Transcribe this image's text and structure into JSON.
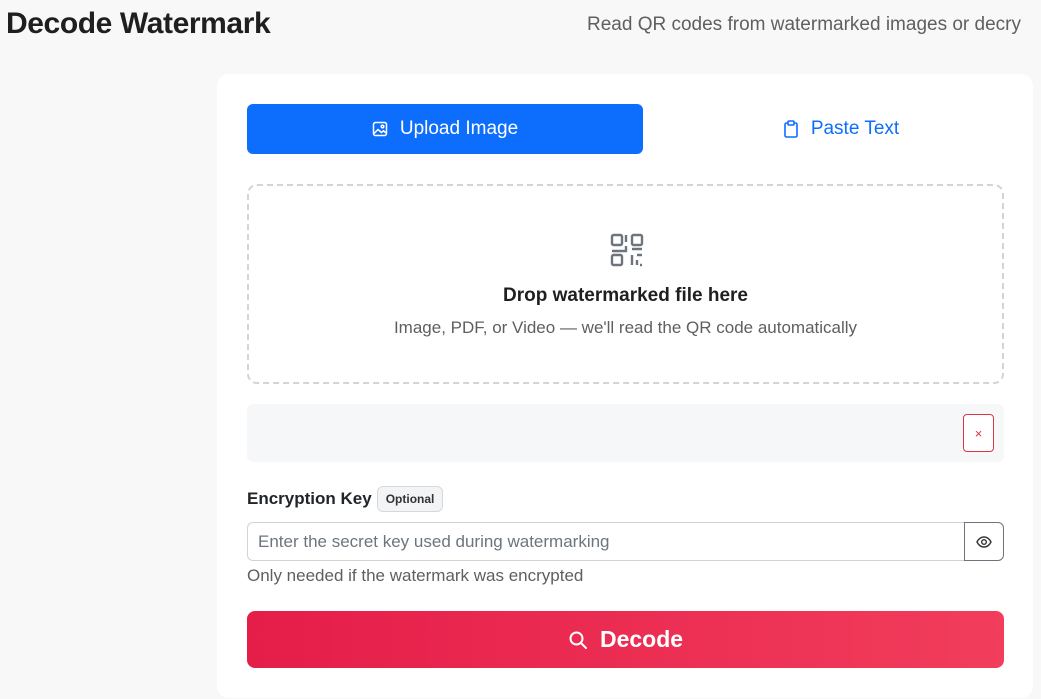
{
  "header": {
    "title": "Decode Watermark",
    "subtitle": "Read QR codes from watermarked images or decry"
  },
  "tabs": {
    "upload_label": "Upload Image",
    "paste_label": "Paste Text",
    "active": "upload"
  },
  "dropzone": {
    "icon": "qr-code-icon",
    "title": "Drop watermarked file here",
    "hint": "Image, PDF, or Video — we'll read the QR code automatically"
  },
  "file_preview": {
    "file_name": "",
    "remove_label": "×"
  },
  "encryption_key": {
    "label": "Encryption Key",
    "badge": "Optional",
    "value": "",
    "placeholder": "Enter the secret key used during watermarking",
    "help": "Only needed if the watermark was encrypted",
    "toggle_icon": "eye-icon"
  },
  "decode_button": {
    "label": "Decode",
    "icon": "search-icon"
  },
  "colors": {
    "primary": "#0d6efd",
    "danger": "#dc3545",
    "decode_gradient_start": "#e51d49",
    "decode_gradient_end": "#f23d5c"
  }
}
